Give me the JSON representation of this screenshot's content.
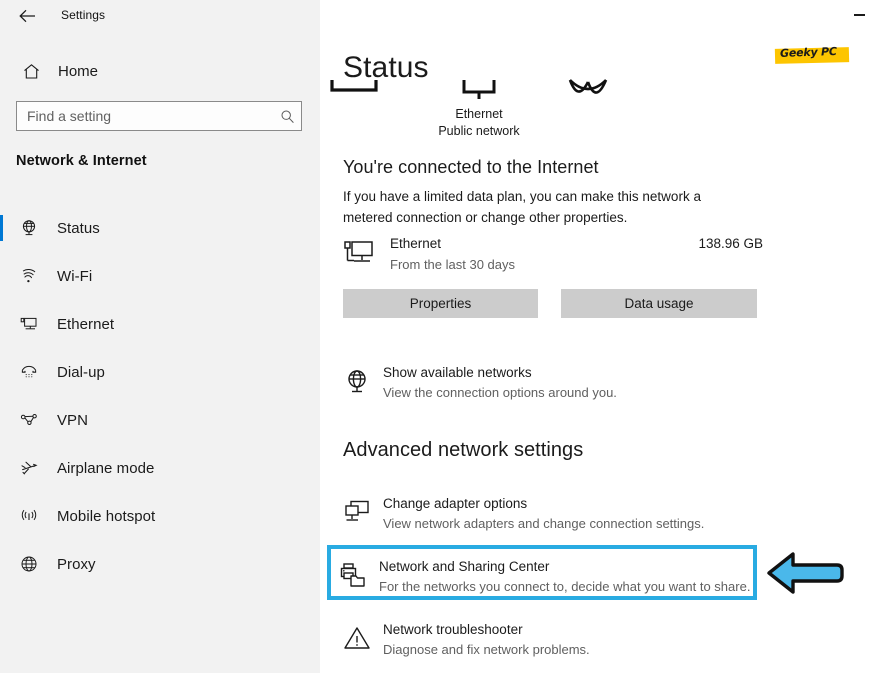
{
  "window": {
    "app_title": "Settings",
    "back_icon": "back-arrow-icon",
    "minimize_icon": "minimize-icon"
  },
  "sidebar": {
    "home_label": "Home",
    "home_icon": "home-icon",
    "search": {
      "placeholder": "Find a setting",
      "value": "",
      "icon": "search-icon"
    },
    "category_title": "Network & Internet",
    "items": [
      {
        "label": "Status",
        "icon": "globe-monitor-icon",
        "selected": true
      },
      {
        "label": "Wi-Fi",
        "icon": "wifi-icon",
        "selected": false
      },
      {
        "label": "Ethernet",
        "icon": "ethernet-icon",
        "selected": false
      },
      {
        "label": "Dial-up",
        "icon": "dialup-phone-icon",
        "selected": false
      },
      {
        "label": "VPN",
        "icon": "vpn-icon",
        "selected": false
      },
      {
        "label": "Airplane mode",
        "icon": "airplane-icon",
        "selected": false
      },
      {
        "label": "Mobile hotspot",
        "icon": "hotspot-icon",
        "selected": false
      },
      {
        "label": "Proxy",
        "icon": "globe-icon",
        "selected": false
      }
    ]
  },
  "main": {
    "page_title": "Status",
    "watermark": "Geeky PC",
    "network_diagram": {
      "connection_label": "Ethernet",
      "network_type_label": "Public network"
    },
    "connected_heading": "You're connected to the Internet",
    "metered_text": "If you have a limited data plan, you can make this network a metered connection or change other properties.",
    "usage": {
      "icon": "ethernet-icon",
      "name": "Ethernet",
      "period": "From the last 30 days",
      "amount": "138.96 GB"
    },
    "buttons": {
      "properties": "Properties",
      "data_usage": "Data usage"
    },
    "show_networks": {
      "icon": "globe-monitor-icon",
      "title": "Show available networks",
      "subtitle": "View the connection options around you."
    },
    "section_title": "Advanced network settings",
    "adapter_options": {
      "icon": "adapter-icon",
      "title": "Change adapter options",
      "subtitle": "View network adapters and change connection settings."
    },
    "sharing_center": {
      "icon": "printer-share-icon",
      "title": "Network and Sharing Center",
      "subtitle": "For the networks you connect to, decide what you want to share."
    },
    "troubleshooter": {
      "icon": "warning-triangle-icon",
      "title": "Network troubleshooter",
      "subtitle": "Diagnose and fix network problems."
    }
  },
  "annotations": {
    "highlight_color": "#29abe2",
    "arrow_color": "#4ab8ea",
    "arrow_direction": "left",
    "accent_color": "#0078d4",
    "watermark_highlight": "#fdc500"
  }
}
